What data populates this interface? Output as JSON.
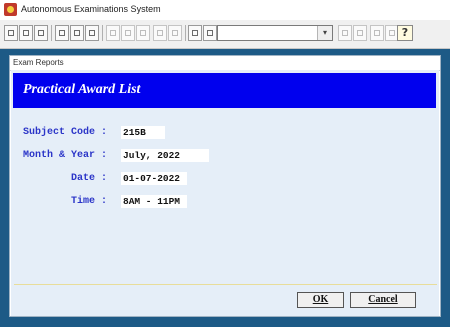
{
  "window": {
    "title": "Autonomous Examinations System"
  },
  "toolbar": {
    "help_glyph": "?",
    "combo_value": ""
  },
  "dialog": {
    "header": "Exam Reports",
    "banner_title": "Practical Award List",
    "fields": [
      {
        "label": "Subject Code :",
        "value": "215B"
      },
      {
        "label": "Month & Year :",
        "value": "July, 2022"
      },
      {
        "label": "Date :",
        "value": "01-07-2022"
      },
      {
        "label": "Time :",
        "value": "8AM - 11PM"
      }
    ],
    "ok_label": "OK",
    "cancel_label": "Cancel"
  },
  "colors": {
    "banner": "#0000ee",
    "label_text": "#2b35c8",
    "dialog_body": "#e5eef8",
    "desktop": "#1d5a86"
  }
}
